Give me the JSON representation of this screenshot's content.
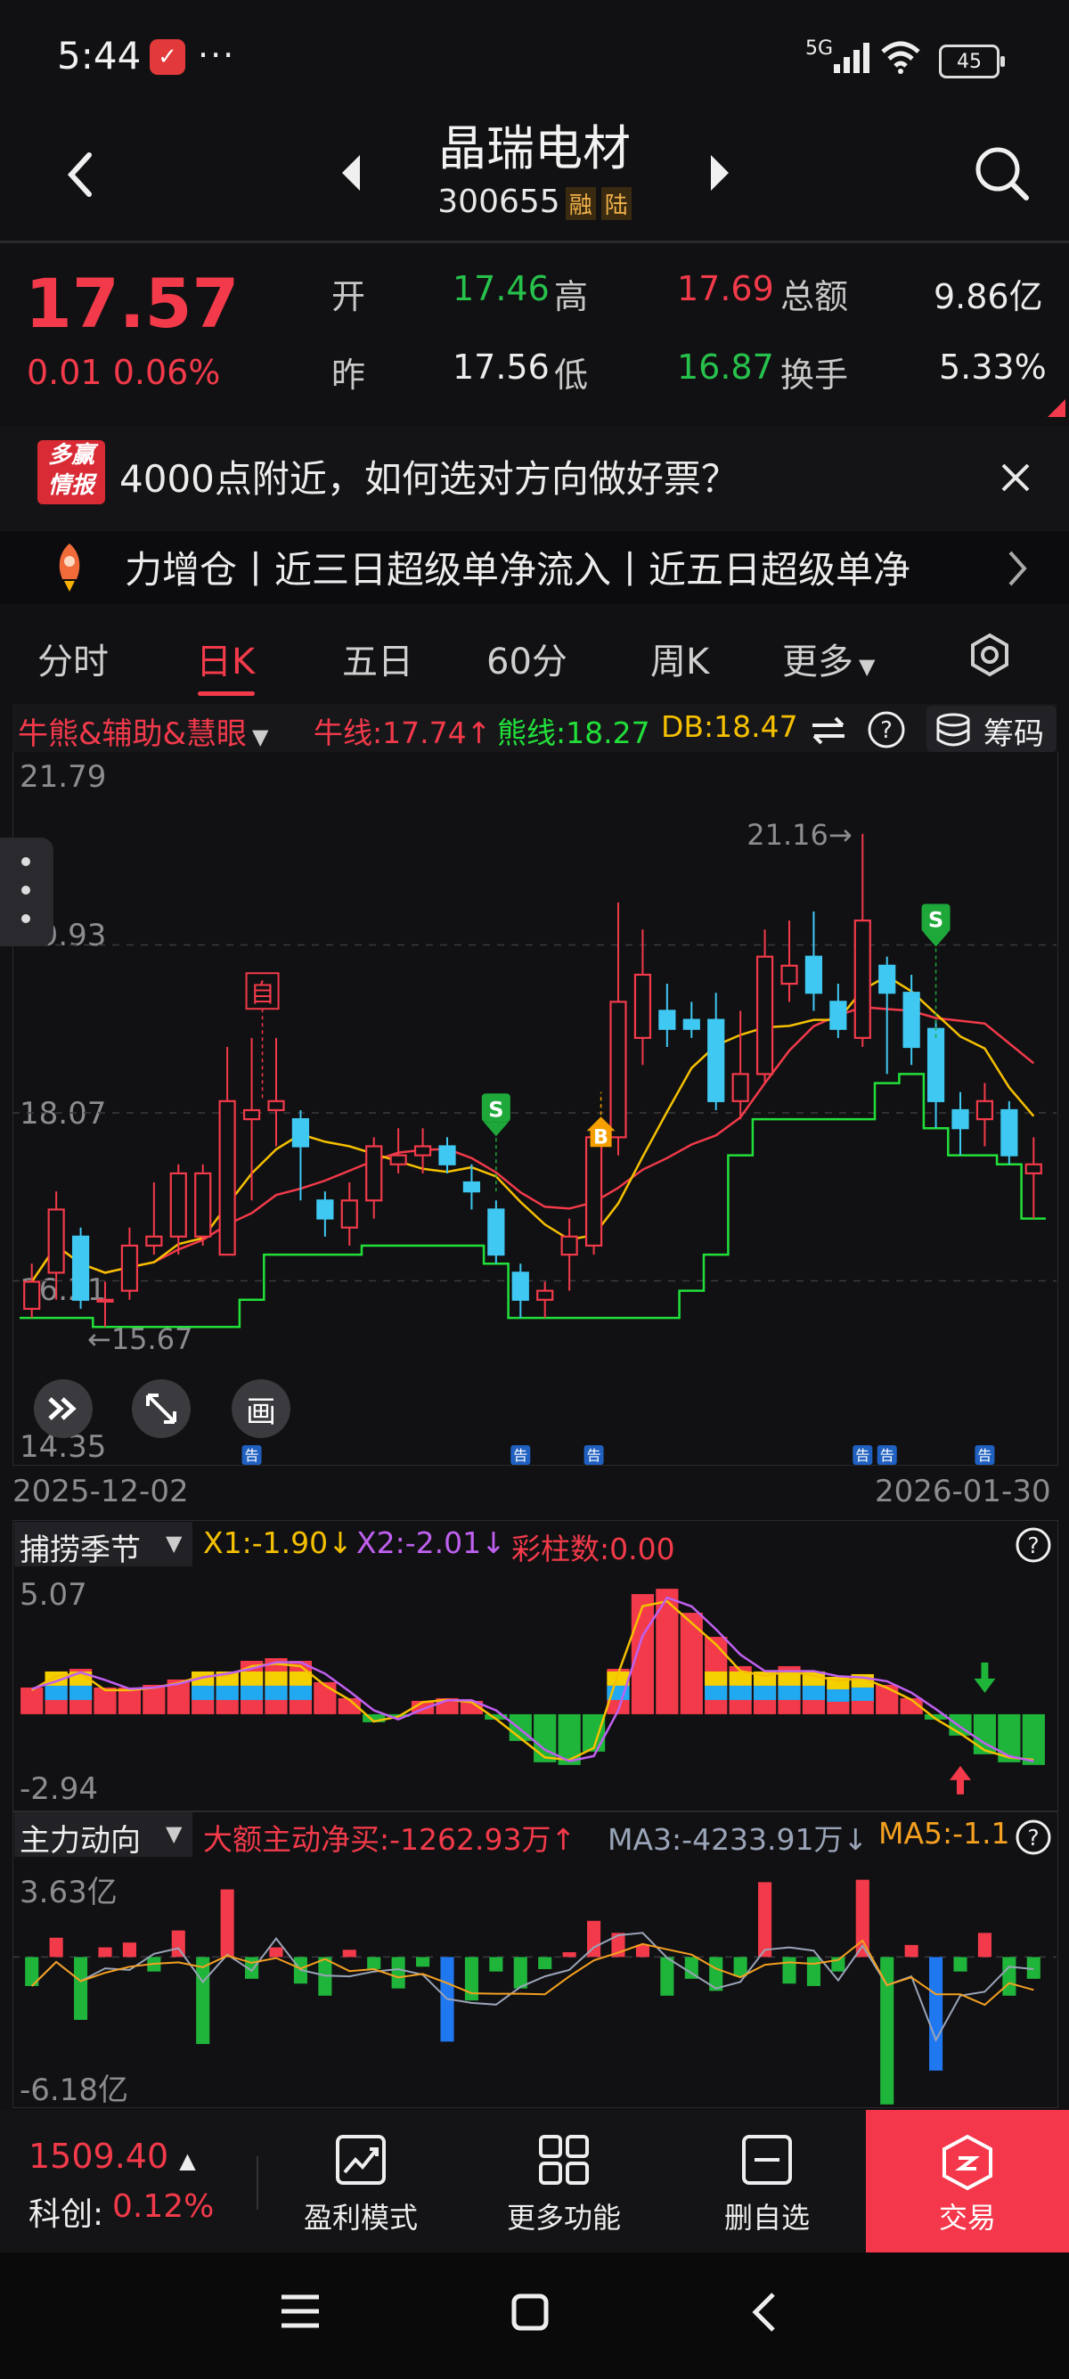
{
  "status_bar": {
    "time": "5:44",
    "network": "5G",
    "battery": "45"
  },
  "header": {
    "title": "晶瑞电材",
    "code": "300655",
    "tag1": "融",
    "tag2": "陆"
  },
  "quote": {
    "price": "17.57",
    "change": "0.01 0.06%",
    "open_label": "开",
    "open": "17.46",
    "high_label": "高",
    "high": "17.69",
    "amount_label": "总额",
    "amount": "9.86亿",
    "prev_label": "昨",
    "prev": "17.56",
    "low_label": "低",
    "low": "16.87",
    "turnover_label": "换手",
    "turnover": "5.33%"
  },
  "ad": {
    "logo_top": "多赢",
    "logo_bottom": "情报",
    "text": "4000点附近，如何选对方向做好票？"
  },
  "ticker": {
    "text": "力增仓丨近三日超级单净流入丨近五日超级单净"
  },
  "tabs": [
    {
      "label": "分时"
    },
    {
      "label": "日K"
    },
    {
      "label": "五日"
    },
    {
      "label": "60分"
    },
    {
      "label": "周K"
    },
    {
      "label": "更多"
    }
  ],
  "main_chart": {
    "indicator_name": "牛熊&辅助&慧眼",
    "bull_line": "牛线:17.74↑",
    "bear_line": "熊线:18.27",
    "db": "DB:18.47",
    "chips_label": "筹码",
    "y_ticks": [
      "21.79",
      "19.93",
      "18.07",
      "16.21",
      "14.35"
    ],
    "high_annot": "21.16→",
    "low_annot": "←15.67",
    "date_start": "2025-12-02",
    "date_end": "2026-01-30",
    "signal_self": "自",
    "signal_s": "S",
    "signal_b": "B",
    "notice": "告",
    "draw_btn": "画",
    "colors": {
      "up": "#f23a4a",
      "down": "#3fc8f2",
      "ma_yellow": "#f5c000",
      "ma_red": "#f23a4a",
      "bull_green": "#22e03a"
    }
  },
  "chart_data": [
    {
      "type": "candlestick",
      "x_range": [
        "2025-12-02",
        "2026-01-30"
      ],
      "ylim": [
        14.35,
        21.79
      ],
      "candles": [
        {
          "o": 15.9,
          "c": 16.2,
          "h": 16.4,
          "l": 15.8
        },
        {
          "o": 16.3,
          "c": 17.0,
          "h": 17.2,
          "l": 16.0
        },
        {
          "o": 16.7,
          "c": 16.0,
          "h": 16.8,
          "l": 15.9
        },
        {
          "o": 16.0,
          "c": 16.0,
          "h": 16.2,
          "l": 15.7
        },
        {
          "o": 16.1,
          "c": 16.6,
          "h": 16.8,
          "l": 16.0
        },
        {
          "o": 16.6,
          "c": 16.7,
          "h": 17.3,
          "l": 16.5
        },
        {
          "o": 16.7,
          "c": 17.4,
          "h": 17.5,
          "l": 16.5
        },
        {
          "o": 16.7,
          "c": 17.4,
          "h": 17.5,
          "l": 16.6
        },
        {
          "o": 16.5,
          "c": 18.2,
          "h": 18.8,
          "l": 16.5
        },
        {
          "o": 18.0,
          "c": 18.1,
          "h": 18.9,
          "l": 17.1
        },
        {
          "o": 18.1,
          "c": 18.2,
          "h": 18.9,
          "l": 17.7
        },
        {
          "o": 18.0,
          "c": 17.7,
          "h": 18.1,
          "l": 17.1
        },
        {
          "o": 17.1,
          "c": 16.9,
          "h": 17.2,
          "l": 16.7
        },
        {
          "o": 16.8,
          "c": 17.1,
          "h": 17.3,
          "l": 16.6
        },
        {
          "o": 17.1,
          "c": 17.7,
          "h": 17.8,
          "l": 16.9
        },
        {
          "o": 17.5,
          "c": 17.6,
          "h": 17.9,
          "l": 17.4
        },
        {
          "o": 17.6,
          "c": 17.7,
          "h": 17.9,
          "l": 17.4
        },
        {
          "o": 17.7,
          "c": 17.5,
          "h": 17.8,
          "l": 17.4
        },
        {
          "o": 17.3,
          "c": 17.2,
          "h": 17.5,
          "l": 17.0
        },
        {
          "o": 17.0,
          "c": 16.5,
          "h": 17.1,
          "l": 16.4
        },
        {
          "o": 16.3,
          "c": 16.0,
          "h": 16.4,
          "l": 15.8
        },
        {
          "o": 16.0,
          "c": 16.1,
          "h": 16.2,
          "l": 15.8
        },
        {
          "o": 16.5,
          "c": 16.7,
          "h": 16.9,
          "l": 16.1
        },
        {
          "o": 16.6,
          "c": 17.8,
          "h": 17.9,
          "l": 16.5
        },
        {
          "o": 17.8,
          "c": 19.3,
          "h": 20.4,
          "l": 17.6
        },
        {
          "o": 18.9,
          "c": 19.6,
          "h": 20.1,
          "l": 18.6
        },
        {
          "o": 19.2,
          "c": 19.0,
          "h": 19.5,
          "l": 18.8
        },
        {
          "o": 19.1,
          "c": 19.0,
          "h": 19.3,
          "l": 18.9
        },
        {
          "o": 19.1,
          "c": 18.2,
          "h": 19.4,
          "l": 18.1
        },
        {
          "o": 18.2,
          "c": 18.5,
          "h": 19.2,
          "l": 18.0
        },
        {
          "o": 18.5,
          "c": 19.8,
          "h": 20.1,
          "l": 18.4
        },
        {
          "o": 19.5,
          "c": 19.7,
          "h": 20.2,
          "l": 19.3
        },
        {
          "o": 19.8,
          "c": 19.4,
          "h": 20.3,
          "l": 19.2
        },
        {
          "o": 19.3,
          "c": 19.0,
          "h": 19.5,
          "l": 18.9
        },
        {
          "o": 18.9,
          "c": 20.2,
          "h": 21.16,
          "l": 18.8
        },
        {
          "o": 19.7,
          "c": 19.4,
          "h": 19.8,
          "l": 18.5
        },
        {
          "o": 19.4,
          "c": 18.8,
          "h": 19.6,
          "l": 18.6
        },
        {
          "o": 19.0,
          "c": 18.2,
          "h": 19.1,
          "l": 17.9
        },
        {
          "o": 18.1,
          "c": 17.9,
          "h": 18.3,
          "l": 17.6
        },
        {
          "o": 18.0,
          "c": 18.2,
          "h": 18.4,
          "l": 17.7
        },
        {
          "o": 18.1,
          "c": 17.6,
          "h": 18.2,
          "l": 17.5
        },
        {
          "o": 17.4,
          "c": 17.5,
          "h": 17.8,
          "l": 16.9
        }
      ]
    },
    {
      "type": "bar",
      "indicator": "捕捞季节",
      "series_labels": [
        "X1:-1.90↓",
        "X2:-2.01↓",
        "彩柱数:0.00"
      ],
      "ylim": [
        -2.94,
        5.07
      ],
      "values": [
        1.0,
        1.6,
        1.7,
        1.0,
        1.0,
        1.1,
        1.3,
        1.6,
        1.6,
        2.0,
        2.1,
        2.0,
        1.2,
        0.6,
        -0.3,
        -0.1,
        0.5,
        0.6,
        0.5,
        -0.2,
        -1.0,
        -1.8,
        -1.9,
        -1.4,
        1.7,
        4.5,
        4.7,
        3.8,
        2.9,
        1.8,
        1.6,
        1.8,
        1.6,
        1.4,
        1.5,
        1.1,
        0.6,
        -0.2,
        -0.8,
        -1.5,
        -1.8,
        -1.9
      ]
    },
    {
      "type": "bar",
      "indicator": "主力动向",
      "series_labels": [
        "大额主动净买:-1262.93万↑",
        "MA3:-4233.91万↓",
        "MA5:-1.1"
      ],
      "ylim": [
        "-6.18亿",
        "3.63亿"
      ],
      "values": [
        -1.2,
        0.8,
        -2.6,
        0.4,
        0.6,
        -0.6,
        1.1,
        -3.6,
        2.8,
        -0.9,
        0.4,
        -1.1,
        -1.6,
        0.3,
        -0.5,
        -1.3,
        -0.4,
        -3.5,
        -1.8,
        -0.6,
        -1.3,
        -0.5,
        0.2,
        1.5,
        1.0,
        0.5,
        -1.6,
        -0.9,
        -1.4,
        -0.8,
        3.1,
        -1.1,
        -1.2,
        -0.6,
        3.2,
        -6.1,
        0.5,
        -4.7,
        -0.6,
        1.0,
        -1.6,
        -0.9
      ]
    }
  ],
  "sub1": {
    "name": "捕捞季节",
    "x1": "X1:-1.90↓",
    "x2": "X2:-2.01↓",
    "bars": "彩柱数:0.00",
    "y_top": "5.07",
    "y_bottom": "-2.94"
  },
  "sub2": {
    "name": "主力动向",
    "net": "大额主动净买:-1262.93万↑",
    "ma3": "MA3:-4233.91万↓",
    "ma5": "MA5:-1.1",
    "y_top": "3.63亿",
    "y_bottom": "-6.18亿"
  },
  "bottom": {
    "index_value": "1509.40",
    "index_name": "科创:",
    "index_change": "0.12%",
    "btn1": "盈利模式",
    "btn2": "更多功能",
    "btn3": "删自选",
    "btn4": "交易"
  }
}
